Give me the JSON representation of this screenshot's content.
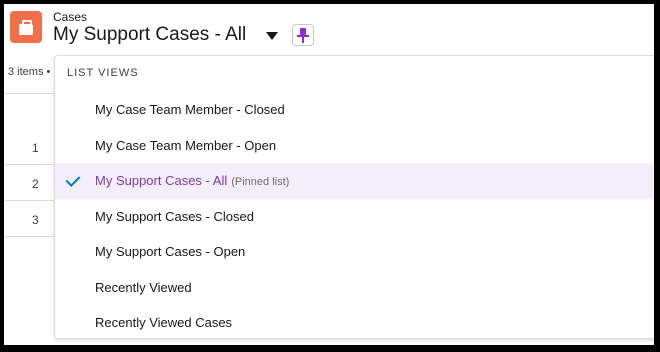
{
  "header": {
    "object_name": "Cases",
    "list_view_title": "My Support Cases - All",
    "icons": {
      "app": "briefcase-icon",
      "dropdown": "caret-down-icon",
      "pin": "pin-icon"
    },
    "colors": {
      "app_icon_bg": "#f36e4b",
      "pin": "#8a2be2"
    }
  },
  "list": {
    "items_count": "3 items •",
    "row_numbers": [
      "1",
      "2",
      "3"
    ]
  },
  "dropdown": {
    "section_title": "LIST VIEWS",
    "selected_color": "#7b3bb5",
    "check_color": "#0176d3",
    "items": [
      {
        "label": "My Case Team Member - Closed",
        "note": ""
      },
      {
        "label": "My Case Team Member - Open",
        "note": ""
      },
      {
        "label": "My Support Cases - All",
        "note": "(Pinned list)"
      },
      {
        "label": "My Support Cases - Closed",
        "note": ""
      },
      {
        "label": "My Support Cases - Open",
        "note": ""
      },
      {
        "label": "Recently Viewed",
        "note": ""
      },
      {
        "label": "Recently Viewed Cases",
        "note": ""
      }
    ]
  }
}
